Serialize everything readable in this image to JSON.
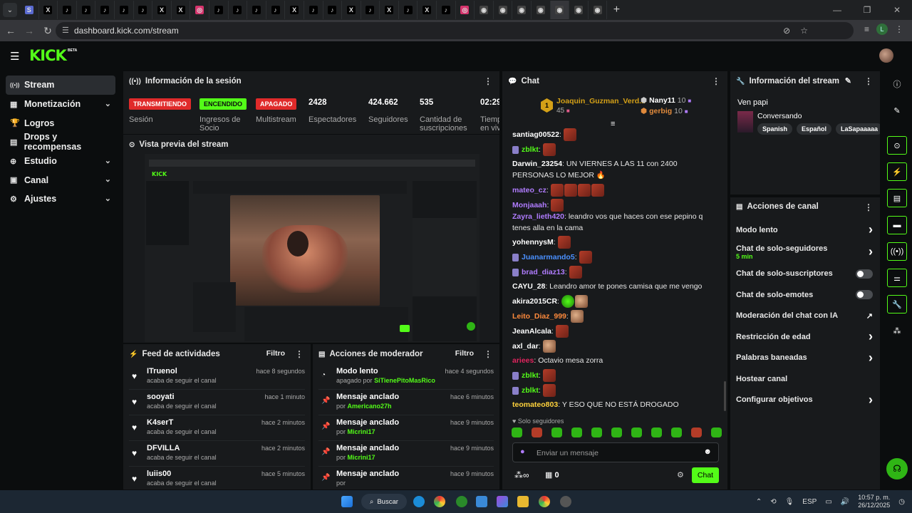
{
  "browser": {
    "url": "dashboard.kick.com/stream",
    "tabs": [
      "S",
      "X",
      "t",
      "t",
      "t",
      "t",
      "t",
      "X",
      "X",
      "ig",
      "t",
      "t",
      "t",
      "t",
      "X",
      "t",
      "t",
      "X",
      "t",
      "X",
      "t",
      "X",
      "t",
      "ig",
      "o",
      "o",
      "o",
      "o",
      "o",
      "o",
      "o"
    ],
    "profile_initial": "L"
  },
  "app": {
    "logo": "KICK",
    "beta": "BETA"
  },
  "sidebar": {
    "items": [
      {
        "label": "Stream",
        "icon": "stream-icon",
        "glyph": "((•))"
      },
      {
        "label": "Monetización",
        "icon": "money-icon",
        "glyph": "▦"
      },
      {
        "label": "Logros",
        "icon": "trophy-icon",
        "glyph": "🏆"
      },
      {
        "label": "Drops y recompensas",
        "icon": "gift-icon",
        "glyph": "▤"
      },
      {
        "label": "Estudio",
        "icon": "studio-icon",
        "glyph": "⊕"
      },
      {
        "label": "Canal",
        "icon": "channel-icon",
        "glyph": "▣"
      },
      {
        "label": "Ajustes",
        "icon": "gear-icon",
        "glyph": "⚙"
      }
    ]
  },
  "session": {
    "title": "Información de la sesión",
    "badges": [
      {
        "text": "TRANSMITIENDO",
        "label": "Sesión",
        "bg": "#e02a2a",
        "color": "#ffffff"
      },
      {
        "text": "ENCENDIDO",
        "label": "Ingresos de Socio",
        "bg": "#53fc18",
        "color": "#0b0d0e"
      },
      {
        "text": "APAGADO",
        "label": "Multistream",
        "bg": "#e02a2a",
        "color": "#ffffff"
      }
    ],
    "stats": [
      {
        "value": "2428",
        "label": "Espectadores"
      },
      {
        "value": "424.662",
        "label": "Seguidores"
      },
      {
        "value": "535",
        "label": "Cantidad de suscripciones"
      },
      {
        "value": "02:29:",
        "label": "Tiemp en viv"
      }
    ]
  },
  "preview": {
    "title": "Vista previa del stream"
  },
  "feed": {
    "title": "Feed de actividades",
    "filter": "Filtro",
    "items": [
      {
        "name": "ITruenol",
        "sub": "acaba de seguir el canal",
        "time": "hace 8 segundos"
      },
      {
        "name": "sooyati",
        "sub": "acaba de seguir el canal",
        "time": "hace 1 minuto"
      },
      {
        "name": "K4serT",
        "sub": "acaba de seguir el canal",
        "time": "hace 2 minutos"
      },
      {
        "name": "DFVILLA",
        "sub": "acaba de seguir el canal",
        "time": "hace 2 minutos"
      },
      {
        "name": "luiis00",
        "sub": "acaba de seguir el canal",
        "time": "hace 5 minutos"
      }
    ]
  },
  "moderator": {
    "title": "Acciones de moderador",
    "filter": "Filtro",
    "items": [
      {
        "name": "Modo lento",
        "prefix": "apagado por",
        "user": "SiTienePitoMasRico",
        "time": "hace 4 segundos",
        "icon": "slow-icon"
      },
      {
        "name": "Mensaje anclado",
        "prefix": "por",
        "user": "Americano27h",
        "time": "hace 6 minutos",
        "icon": "pin-icon"
      },
      {
        "name": "Mensaje anclado",
        "prefix": "por",
        "user": "Micrini17",
        "time": "hace 9 minutos",
        "icon": "pin-icon"
      },
      {
        "name": "Mensaje anclado",
        "prefix": "por",
        "user": "Micrini17",
        "time": "hace 9 minutos",
        "icon": "pin-icon"
      },
      {
        "name": "Mensaje anclado",
        "prefix": "por",
        "user": "",
        "time": "hace 9 minutos",
        "icon": "pin-icon"
      }
    ]
  },
  "chat": {
    "title": "Chat",
    "top_gifter": {
      "rank": "1",
      "name": "Joaquin_Guzman_Verd...",
      "count": "45"
    },
    "gifters": [
      {
        "name": "Nany11",
        "count": "10"
      },
      {
        "name": "gerbig",
        "count": "10"
      }
    ],
    "messages": [
      {
        "user": "santiag00522",
        "color": "#ffffff",
        "text": "",
        "emotes": 1,
        "mod": false
      },
      {
        "user": "zblkt",
        "color": "#53fc18",
        "text": "",
        "emotes": 1,
        "mod": true
      },
      {
        "user": "Darwin_23254",
        "color": "#ffffff",
        "text": "UN VIERNES A LAS 11 con 2400 PERSONAS LO MEJOR 🔥",
        "emotes": 0,
        "mod": false
      },
      {
        "user": "mateo_cz",
        "color": "#b07cff",
        "text": "",
        "emotes": 4,
        "mod": false
      },
      {
        "user": "Monjaaah",
        "color": "#b07cff",
        "text": "",
        "emotes": 1,
        "mod": false
      },
      {
        "user": "Zayra_lieth420",
        "color": "#b07cff",
        "text": "leandro vos que haces con ese pepino q tenes alla en la cama",
        "emotes": 0,
        "mod": false
      },
      {
        "user": "yohennysM",
        "color": "#ffffff",
        "text": "",
        "emotes": 1,
        "mod": false
      },
      {
        "user": "Juanarmando5",
        "color": "#4a90ff",
        "text": "",
        "emotes": 1,
        "mod": true
      },
      {
        "user": "brad_diaz13",
        "color": "#b07cff",
        "text": "",
        "emotes": 1,
        "mod": true
      },
      {
        "user": "CAYU_28",
        "color": "#ffffff",
        "text": "Leandro amor te pones camisa que me vengo",
        "emotes": 0,
        "mod": false
      },
      {
        "user": "akira2015CR",
        "color": "#ffffff",
        "text": "",
        "emotes": 2,
        "mod": false
      },
      {
        "user": "Leito_Diaz_999",
        "color": "#ff8a3c",
        "text": "",
        "emotes": 1,
        "mod": false
      },
      {
        "user": "JeanAlcala",
        "color": "#ffffff",
        "text": "",
        "emotes": 1,
        "mod": false
      },
      {
        "user": "axl_dar",
        "color": "#ffffff",
        "text": "",
        "emotes": 1,
        "mod": false
      },
      {
        "user": "ariees",
        "color": "#e0245e",
        "text": "Octavio mesa zorra",
        "emotes": 0,
        "mod": false
      },
      {
        "user": "zblkt",
        "color": "#53fc18",
        "text": "",
        "emotes": 1,
        "mod": true
      },
      {
        "user": "zblkt",
        "color": "#53fc18",
        "text": "",
        "emotes": 1,
        "mod": true
      },
      {
        "user": "teomateo803",
        "color": "#ffd23c",
        "text": "Y ESO QUE NO ESTÁ DROGADO",
        "emotes": 0,
        "mod": false
      }
    ],
    "mode": "Solo seguidores",
    "input_placeholder": "Enviar un mensaje",
    "points": "0",
    "send": "Chat"
  },
  "stream_info": {
    "title": "Información del stream",
    "stream_title": "Ven papi",
    "category": "Conversando",
    "tags": [
      "Spanish",
      "Español",
      "LaSapaaaaa"
    ]
  },
  "channel_actions": {
    "title": "Acciones de canal",
    "items": [
      {
        "label": "Modo lento",
        "sub": "",
        "control": "arrow"
      },
      {
        "label": "Chat de solo-seguidores",
        "sub": "5 min",
        "control": "arrow"
      },
      {
        "label": "Chat de solo-suscriptores",
        "sub": "",
        "control": "toggle"
      },
      {
        "label": "Chat de solo-emotes",
        "sub": "",
        "control": "toggle"
      },
      {
        "label": "Moderación del chat con IA",
        "sub": "",
        "control": "external"
      },
      {
        "label": "Restricción de edad",
        "sub": "",
        "control": "arrow"
      },
      {
        "label": "Palabras baneadas",
        "sub": "",
        "control": "arrow"
      },
      {
        "label": "Hostear canal",
        "sub": "",
        "control": "none"
      },
      {
        "label": "Configurar objetivos",
        "sub": "",
        "control": "arrow"
      }
    ]
  },
  "taskbar": {
    "search": "Buscar",
    "lang": "ESP",
    "time": "10:57 p. m.",
    "date": "26/12/2025"
  },
  "colors": {
    "accent": "#53fc18",
    "bg": "#0b0d0e",
    "panel": "#181a1c",
    "live_red": "#e02a2a"
  }
}
